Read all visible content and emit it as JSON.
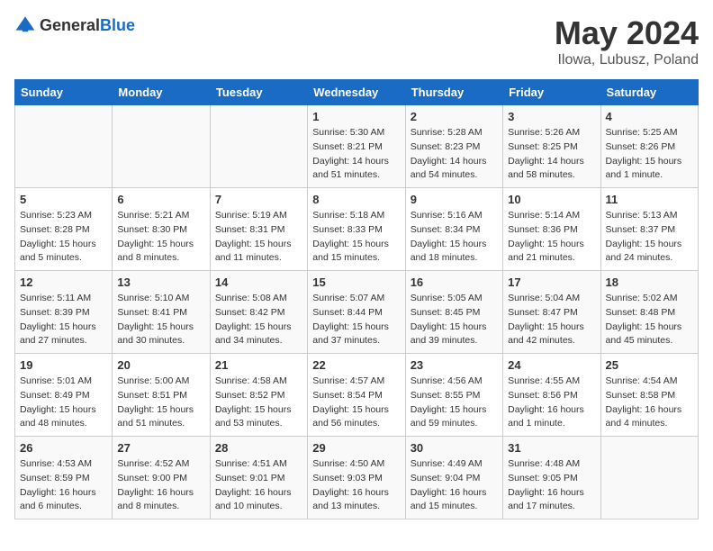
{
  "header": {
    "logo_general": "General",
    "logo_blue": "Blue",
    "month_year": "May 2024",
    "location": "Ilowa, Lubusz, Poland"
  },
  "weekdays": [
    "Sunday",
    "Monday",
    "Tuesday",
    "Wednesday",
    "Thursday",
    "Friday",
    "Saturday"
  ],
  "weeks": [
    [
      {
        "day": "",
        "info": ""
      },
      {
        "day": "",
        "info": ""
      },
      {
        "day": "",
        "info": ""
      },
      {
        "day": "1",
        "info": "Sunrise: 5:30 AM\nSunset: 8:21 PM\nDaylight: 14 hours\nand 51 minutes."
      },
      {
        "day": "2",
        "info": "Sunrise: 5:28 AM\nSunset: 8:23 PM\nDaylight: 14 hours\nand 54 minutes."
      },
      {
        "day": "3",
        "info": "Sunrise: 5:26 AM\nSunset: 8:25 PM\nDaylight: 14 hours\nand 58 minutes."
      },
      {
        "day": "4",
        "info": "Sunrise: 5:25 AM\nSunset: 8:26 PM\nDaylight: 15 hours\nand 1 minute."
      }
    ],
    [
      {
        "day": "5",
        "info": "Sunrise: 5:23 AM\nSunset: 8:28 PM\nDaylight: 15 hours\nand 5 minutes."
      },
      {
        "day": "6",
        "info": "Sunrise: 5:21 AM\nSunset: 8:30 PM\nDaylight: 15 hours\nand 8 minutes."
      },
      {
        "day": "7",
        "info": "Sunrise: 5:19 AM\nSunset: 8:31 PM\nDaylight: 15 hours\nand 11 minutes."
      },
      {
        "day": "8",
        "info": "Sunrise: 5:18 AM\nSunset: 8:33 PM\nDaylight: 15 hours\nand 15 minutes."
      },
      {
        "day": "9",
        "info": "Sunrise: 5:16 AM\nSunset: 8:34 PM\nDaylight: 15 hours\nand 18 minutes."
      },
      {
        "day": "10",
        "info": "Sunrise: 5:14 AM\nSunset: 8:36 PM\nDaylight: 15 hours\nand 21 minutes."
      },
      {
        "day": "11",
        "info": "Sunrise: 5:13 AM\nSunset: 8:37 PM\nDaylight: 15 hours\nand 24 minutes."
      }
    ],
    [
      {
        "day": "12",
        "info": "Sunrise: 5:11 AM\nSunset: 8:39 PM\nDaylight: 15 hours\nand 27 minutes."
      },
      {
        "day": "13",
        "info": "Sunrise: 5:10 AM\nSunset: 8:41 PM\nDaylight: 15 hours\nand 30 minutes."
      },
      {
        "day": "14",
        "info": "Sunrise: 5:08 AM\nSunset: 8:42 PM\nDaylight: 15 hours\nand 34 minutes."
      },
      {
        "day": "15",
        "info": "Sunrise: 5:07 AM\nSunset: 8:44 PM\nDaylight: 15 hours\nand 37 minutes."
      },
      {
        "day": "16",
        "info": "Sunrise: 5:05 AM\nSunset: 8:45 PM\nDaylight: 15 hours\nand 39 minutes."
      },
      {
        "day": "17",
        "info": "Sunrise: 5:04 AM\nSunset: 8:47 PM\nDaylight: 15 hours\nand 42 minutes."
      },
      {
        "day": "18",
        "info": "Sunrise: 5:02 AM\nSunset: 8:48 PM\nDaylight: 15 hours\nand 45 minutes."
      }
    ],
    [
      {
        "day": "19",
        "info": "Sunrise: 5:01 AM\nSunset: 8:49 PM\nDaylight: 15 hours\nand 48 minutes."
      },
      {
        "day": "20",
        "info": "Sunrise: 5:00 AM\nSunset: 8:51 PM\nDaylight: 15 hours\nand 51 minutes."
      },
      {
        "day": "21",
        "info": "Sunrise: 4:58 AM\nSunset: 8:52 PM\nDaylight: 15 hours\nand 53 minutes."
      },
      {
        "day": "22",
        "info": "Sunrise: 4:57 AM\nSunset: 8:54 PM\nDaylight: 15 hours\nand 56 minutes."
      },
      {
        "day": "23",
        "info": "Sunrise: 4:56 AM\nSunset: 8:55 PM\nDaylight: 15 hours\nand 59 minutes."
      },
      {
        "day": "24",
        "info": "Sunrise: 4:55 AM\nSunset: 8:56 PM\nDaylight: 16 hours\nand 1 minute."
      },
      {
        "day": "25",
        "info": "Sunrise: 4:54 AM\nSunset: 8:58 PM\nDaylight: 16 hours\nand 4 minutes."
      }
    ],
    [
      {
        "day": "26",
        "info": "Sunrise: 4:53 AM\nSunset: 8:59 PM\nDaylight: 16 hours\nand 6 minutes."
      },
      {
        "day": "27",
        "info": "Sunrise: 4:52 AM\nSunset: 9:00 PM\nDaylight: 16 hours\nand 8 minutes."
      },
      {
        "day": "28",
        "info": "Sunrise: 4:51 AM\nSunset: 9:01 PM\nDaylight: 16 hours\nand 10 minutes."
      },
      {
        "day": "29",
        "info": "Sunrise: 4:50 AM\nSunset: 9:03 PM\nDaylight: 16 hours\nand 13 minutes."
      },
      {
        "day": "30",
        "info": "Sunrise: 4:49 AM\nSunset: 9:04 PM\nDaylight: 16 hours\nand 15 minutes."
      },
      {
        "day": "31",
        "info": "Sunrise: 4:48 AM\nSunset: 9:05 PM\nDaylight: 16 hours\nand 17 minutes."
      },
      {
        "day": "",
        "info": ""
      }
    ]
  ]
}
